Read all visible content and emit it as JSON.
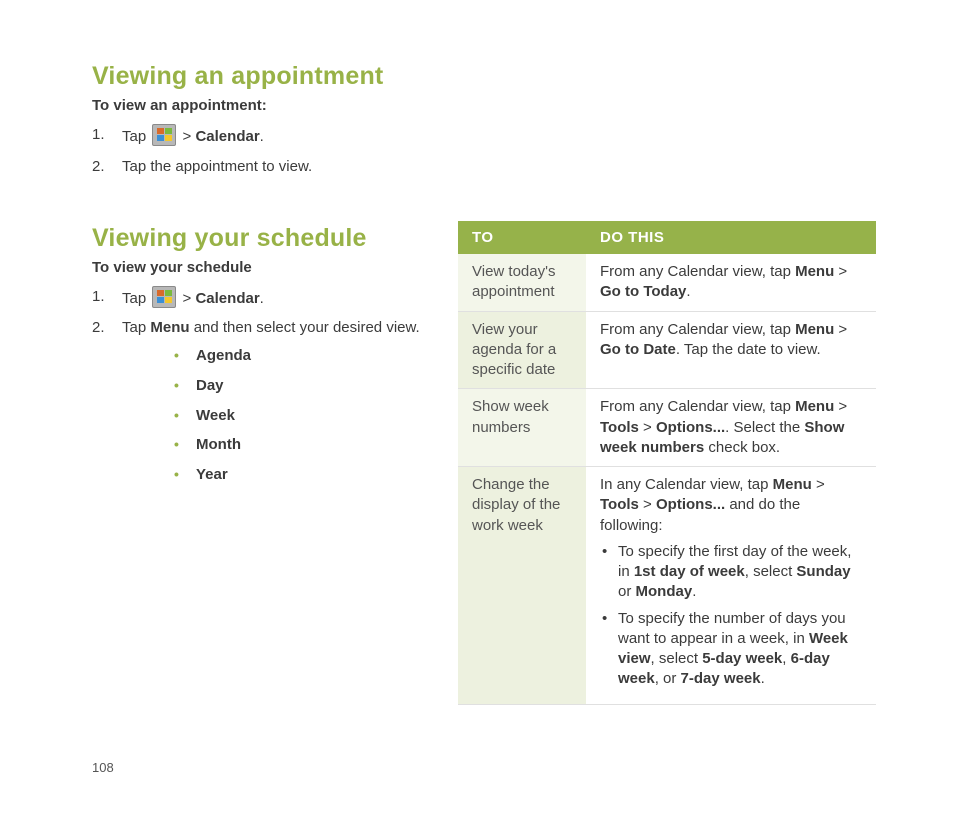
{
  "page_number": "108",
  "section1": {
    "title": "Viewing an appointment",
    "subhead": "To view an appointment:",
    "step1_prefix": "Tap ",
    "step1_gt": " > ",
    "step1_bold": "Calendar",
    "step1_suffix": ".",
    "step2": "Tap the appointment to view."
  },
  "section2": {
    "title": "Viewing your schedule",
    "subhead": "To view your schedule",
    "step1_prefix": "Tap ",
    "step1_gt": " > ",
    "step1_bold": "Calendar",
    "step1_suffix": ".",
    "step2_prefix": "Tap ",
    "step2_bold": "Menu",
    "step2_suffix": " and then select your desired view.",
    "views": {
      "v0": "Agenda",
      "v1": "Day",
      "v2": "Week",
      "v3": "Month",
      "v4": "Year"
    }
  },
  "table": {
    "head_to": "TO",
    "head_do": "DO THIS",
    "r1": {
      "to": "View today's appointment",
      "do_prefix": "From any Calendar view, tap ",
      "menu": "Menu",
      "gt": " > ",
      "action": "Go to Today",
      "suffix": "."
    },
    "r2": {
      "to": "View your agenda for a specific date",
      "do_prefix": "From any Calendar view, tap ",
      "menu": "Menu",
      "gt": " > ",
      "action": "Go to Date",
      "suffix": ". Tap the date to view."
    },
    "r3": {
      "to": "Show week numbers",
      "prefix": "From any Calendar view, tap ",
      "menu": "Menu",
      "gt1": " > ",
      "tools": "Tools",
      "gt2": " > ",
      "options": "Options...",
      "mid": ". Select the ",
      "check": "Show week numbers",
      "suffix": " check box."
    },
    "r4": {
      "to": "Change the display of the work week",
      "prefix": "In any Calendar view, tap ",
      "menu": "Menu",
      "gt1": " > ",
      "tools": "Tools",
      "gt2": " > ",
      "options": "Options...",
      "mid": " and do the following:",
      "b1_prefix": "To specify the first day of the week, in ",
      "b1_field": "1st day of week",
      "b1_mid": ", select ",
      "b1_opt1": "Sunday",
      "b1_or": " or ",
      "b1_opt2": "Monday",
      "b1_suffix": ".",
      "b2_prefix": "To specify the number of days you want to appear in a week, in ",
      "b2_field": "Week view",
      "b2_mid": ", select ",
      "b2_opt1": "5-day week",
      "b2_c1": ", ",
      "b2_opt2": "6-day week",
      "b2_c2": ", or ",
      "b2_opt3": "7-day week",
      "b2_suffix": "."
    }
  }
}
